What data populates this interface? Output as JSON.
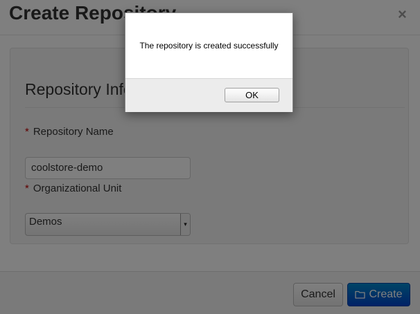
{
  "modal": {
    "title": "Create Repository",
    "close_glyph": "×",
    "legend": "Repository Information",
    "repository_name": {
      "label": "Repository Name",
      "required_marker": "*",
      "value": "coolstore-demo"
    },
    "organizational_unit": {
      "label": "Organizational Unit",
      "required_marker": "*",
      "selected": "Demos",
      "arrow_glyph": "▾"
    },
    "footer": {
      "cancel_label": "Cancel",
      "create_label": "Create",
      "create_icon": "folder-icon"
    }
  },
  "alert": {
    "message": "The repository is created successfully",
    "ok_label": "OK"
  },
  "colors": {
    "primary_button": "#0055cc",
    "required_marker": "#c00000",
    "backdrop": "rgba(0,0,0,0.5)"
  }
}
